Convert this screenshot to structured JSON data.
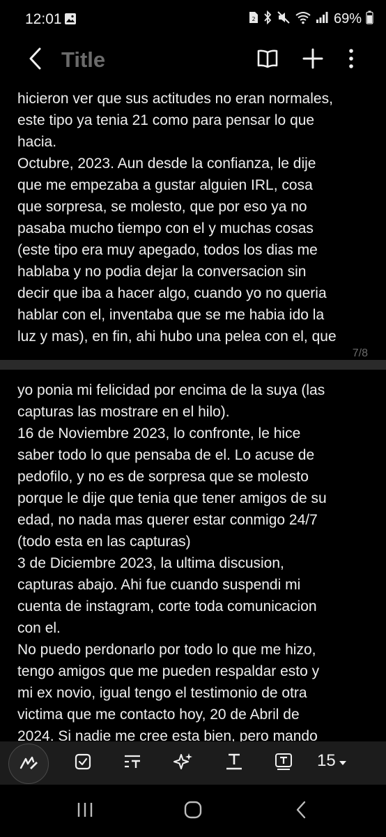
{
  "status_bar": {
    "time": "12:01",
    "battery": "69%"
  },
  "app_bar": {
    "title": "Title"
  },
  "page_1": {
    "text": "hicieron ver que sus actitudes no eran normales,\neste tipo ya tenia 21 como para pensar lo que\nhacia.\nOctubre, 2023. Aun desde la confianza, le dije\nque me empezaba a gustar alguien IRL, cosa\nque sorpresa, se molesto, que por eso ya no\npasaba mucho tiempo con el y muchas cosas\n(este tipo era muy apegado, todos los dias me\nhablaba y no podia dejar la conversacion sin\ndecir que iba a hacer algo, cuando yo no queria\nhablar con el, inventaba que se me habia ido la\nluz y mas), en fin, ahi hubo una pelea con el, que",
    "page_number": "7/8"
  },
  "page_2": {
    "text": "yo ponia mi felicidad por encima de la suya (las\ncapturas las mostrare en el hilo).\n16 de Noviembre 2023, lo confronte, le hice\nsaber todo lo que pensaba de el. Lo acuse de\npedofilo, y no es de sorpresa que se molesto\nporque le dije que tenia que tener amigos de su\nedad, no nada mas querer estar conmigo 24/7\n(todo esta en las capturas)\n3 de Diciembre 2023, la ultima discusion,\ncapturas abajo. Ahi fue cuando suspendi mi\ncuenta de instagram, corte toda comunicacion\ncon el.\nNo puedo perdonarlo por todo lo que me hizo,\ntengo amigos que me pueden respaldar esto y\nmi ex novio, igual tengo el testimonio de otra\nvictima que me contacto hoy, 20 de Abril de\n2024. Si nadie me cree esta bien, pero mando"
  },
  "toolbar": {
    "font_size": "15"
  },
  "icons": {
    "status": [
      "image-icon",
      "sim-icon",
      "bluetooth-icon",
      "mute-icon",
      "wifi-icon",
      "signal-icon",
      "battery-icon"
    ],
    "app_bar": [
      "back-icon",
      "book-icon",
      "plus-icon",
      "more-icon"
    ],
    "toolbar": [
      "pen-icon",
      "checkbox-icon",
      "text-style-icon",
      "sparkle-icon",
      "text-underline-icon",
      "text-box-icon",
      "caret-down-icon"
    ],
    "nav": [
      "recents-icon",
      "home-icon",
      "back-nav-icon"
    ]
  },
  "colors": {
    "background": "#000000",
    "toolbar": "#1c1c1c",
    "page_gap": "#2a2a2a",
    "title": "#6b6b6b",
    "text": "#efefef"
  }
}
